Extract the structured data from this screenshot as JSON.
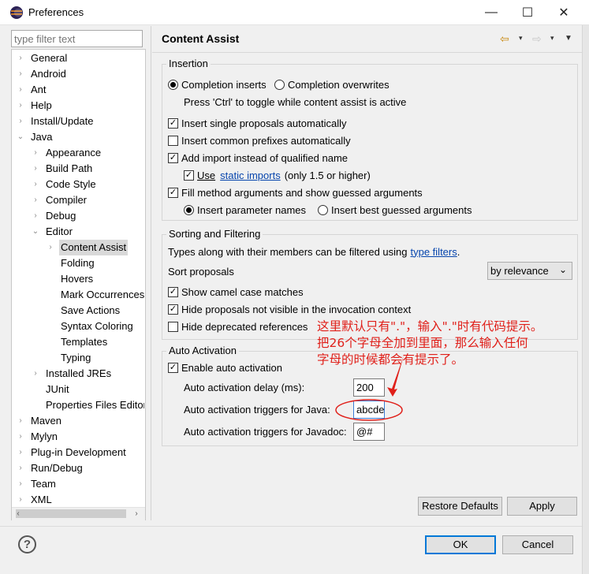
{
  "window": {
    "title": "Preferences",
    "minimize_glyph": "—",
    "maximize_glyph": "☐",
    "close_glyph": "✕"
  },
  "filter": {
    "placeholder": "type filter text"
  },
  "tree": {
    "items": [
      {
        "label": "General",
        "level": 0,
        "twisty": "›"
      },
      {
        "label": "Android",
        "level": 0,
        "twisty": "›"
      },
      {
        "label": "Ant",
        "level": 0,
        "twisty": "›"
      },
      {
        "label": "Help",
        "level": 0,
        "twisty": "›"
      },
      {
        "label": "Install/Update",
        "level": 0,
        "twisty": "›"
      },
      {
        "label": "Java",
        "level": 0,
        "twisty": "⌄"
      },
      {
        "label": "Appearance",
        "level": 1,
        "twisty": "›"
      },
      {
        "label": "Build Path",
        "level": 1,
        "twisty": "›"
      },
      {
        "label": "Code Style",
        "level": 1,
        "twisty": "›"
      },
      {
        "label": "Compiler",
        "level": 1,
        "twisty": "›"
      },
      {
        "label": "Debug",
        "level": 1,
        "twisty": "›"
      },
      {
        "label": "Editor",
        "level": 1,
        "twisty": "⌄"
      },
      {
        "label": "Content Assist",
        "level": 2,
        "twisty": "›",
        "selected": true
      },
      {
        "label": "Folding",
        "level": 2,
        "twisty": ""
      },
      {
        "label": "Hovers",
        "level": 2,
        "twisty": ""
      },
      {
        "label": "Mark Occurrences",
        "level": 2,
        "twisty": ""
      },
      {
        "label": "Save Actions",
        "level": 2,
        "twisty": ""
      },
      {
        "label": "Syntax Coloring",
        "level": 2,
        "twisty": ""
      },
      {
        "label": "Templates",
        "level": 2,
        "twisty": ""
      },
      {
        "label": "Typing",
        "level": 2,
        "twisty": ""
      },
      {
        "label": "Installed JREs",
        "level": 1,
        "twisty": "›"
      },
      {
        "label": "JUnit",
        "level": 1,
        "twisty": ""
      },
      {
        "label": "Properties Files Editor",
        "level": 1,
        "twisty": ""
      },
      {
        "label": "Maven",
        "level": 0,
        "twisty": "›"
      },
      {
        "label": "Mylyn",
        "level": 0,
        "twisty": "›"
      },
      {
        "label": "Plug-in Development",
        "level": 0,
        "twisty": "›"
      },
      {
        "label": "Run/Debug",
        "level": 0,
        "twisty": "›"
      },
      {
        "label": "Team",
        "level": 0,
        "twisty": "›"
      },
      {
        "label": "XML",
        "level": 0,
        "twisty": "›"
      }
    ],
    "scroll_left_glyph": "‹",
    "scroll_right_glyph": "›"
  },
  "page": {
    "title": "Content Assist",
    "back_glyph": "⇦",
    "forward_glyph": "⇨",
    "dropdown_glyph": "▾",
    "menu_glyph": "▼"
  },
  "insertion": {
    "title": "Insertion",
    "completion_inserts": "Completion inserts",
    "completion_overwrites": "Completion overwrites",
    "toggle_hint": "Press 'Ctrl' to toggle while content assist is active",
    "insert_single": "Insert single proposals automatically",
    "insert_common": "Insert common prefixes automatically",
    "add_import": "Add import instead of qualified name",
    "use_label": "Use",
    "static_imports_link": "static imports",
    "only_15": "(only 1.5 or higher)",
    "fill_method": "Fill method arguments and show guessed arguments",
    "insert_param_names": "Insert parameter names",
    "insert_best_guessed": "Insert best guessed arguments",
    "check_glyph": "✓"
  },
  "sorting": {
    "title": "Sorting and Filtering",
    "types_text": "Types along with their members can be filtered using",
    "type_filters_link": "type filters",
    "period": ".",
    "sort_proposals_label": "Sort proposals",
    "sort_value": "by relevance",
    "sort_arrow": "⌄",
    "show_camel": "Show camel case matches",
    "hide_not_visible": "Hide proposals not visible in the invocation context",
    "hide_deprecated": "Hide deprecated references"
  },
  "auto_activation": {
    "title": "Auto Activation",
    "enable": "Enable auto activation",
    "delay_label": "Auto activation delay (ms):",
    "delay_value": "200",
    "java_label": "Auto activation triggers for Java:",
    "java_value": "abcdefghijklmnopqrstuvwxyz.",
    "javadoc_label": "Auto activation triggers for Javadoc:",
    "javadoc_value": "@#"
  },
  "annotation": {
    "line1": "这里默认只有\".\"，输入\".\"时有代码提示。",
    "line2": "把26个字母全加到里面，那么输入任何",
    "line3": "字母的时候都会有提示了。"
  },
  "buttons": {
    "restore_defaults": "Restore Defaults",
    "apply": "Apply",
    "ok": "OK",
    "cancel": "Cancel",
    "help_glyph": "?"
  },
  "colors": {
    "annotation_red": "#e0201a",
    "selection": "#d9d9d9",
    "link_blue": "#0645ad"
  }
}
